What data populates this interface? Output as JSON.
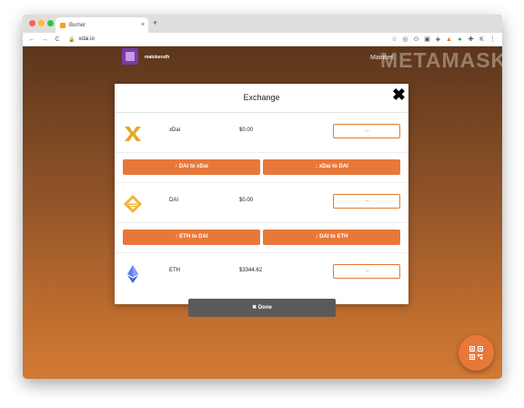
{
  "browser": {
    "tab_title": "Burner",
    "tab_close": "×",
    "new_tab": "+",
    "url": "xdai.io",
    "nav_back": "←",
    "nav_forward": "→",
    "nav_reload": "C"
  },
  "header": {
    "username": "matokeruth",
    "network": "Mainnet",
    "watermark": "METAMASK"
  },
  "exchange": {
    "title": "Exchange",
    "close_label": "✖",
    "rows": [
      {
        "name": "xDai",
        "balance": "$0.00",
        "send_label": "→"
      },
      {
        "name": "DAI",
        "balance": "$0.00",
        "send_label": "→"
      },
      {
        "name": "ETH",
        "balance": "$3344.62",
        "send_label": "→"
      }
    ],
    "buttons": [
      {
        "left": "↑ DAI to xDai",
        "right": "↓ xDai to DAI"
      },
      {
        "left": "↑ ETH to DAI",
        "right": "↓ DAI to ETH"
      }
    ]
  },
  "done_label": "✖ Done",
  "colors": {
    "accent": "#e8783a",
    "done_bg": "#5a5a5a",
    "xdai": "#e5a823",
    "dai": "#f2b134",
    "eth": "#627eea"
  },
  "icons": [
    "xdai-icon",
    "dai-icon",
    "eth-icon",
    "qr-scan-icon"
  ]
}
